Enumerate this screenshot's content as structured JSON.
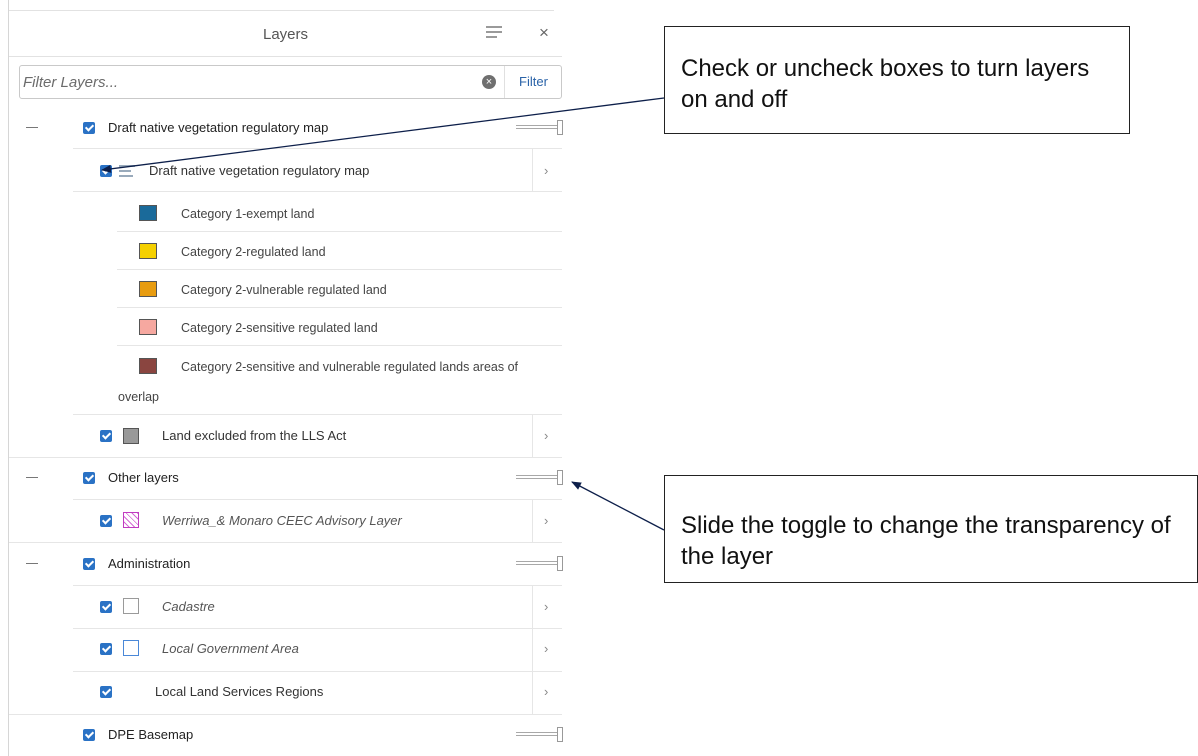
{
  "panel": {
    "title": "Layers",
    "filter_placeholder": "Filter Layers...",
    "filter_button": "Filter",
    "close_glyph": "×",
    "clear_glyph": "×"
  },
  "groups": [
    {
      "label": "Draft native vegetation regulatory map",
      "sublayer": {
        "label": "Draft native vegetation regulatory map",
        "legend": [
          {
            "label": "Category 1-exempt land",
            "color": "#1a6a9a"
          },
          {
            "label": "Category 2-regulated land",
            "color": "#f5d000"
          },
          {
            "label": "Category 2-vulnerable regulated land",
            "color": "#e89c10"
          },
          {
            "label": "Category 2-sensitive regulated land",
            "color": "#f6a8a0"
          },
          {
            "label": "Category 2-sensitive and vulnerable regulated lands areas of",
            "label_cont": "overlap",
            "color": "#8a4540"
          }
        ]
      },
      "extra_sublayer": {
        "label": "Land excluded from the LLS Act",
        "color": "#999999"
      }
    },
    {
      "label": "Other layers",
      "sublayers": [
        {
          "label": "Werriwa_& Monaro CEEC Advisory Layer",
          "color": "#c03cc0"
        }
      ]
    },
    {
      "label": "Administration",
      "sublayers": [
        {
          "label": "Cadastre",
          "color": "#9a9a9a"
        },
        {
          "label": "Local Government Area",
          "color": "#4a88d8"
        },
        {
          "label": "Local Land Services Regions"
        }
      ]
    },
    {
      "label": "DPE Basemap"
    }
  ],
  "callouts": {
    "checkbox_tip": "Check or uncheck boxes to turn layers on and off",
    "slider_tip": "Slide the toggle to change the transparency of the layer"
  },
  "chevron_glyph": "›"
}
